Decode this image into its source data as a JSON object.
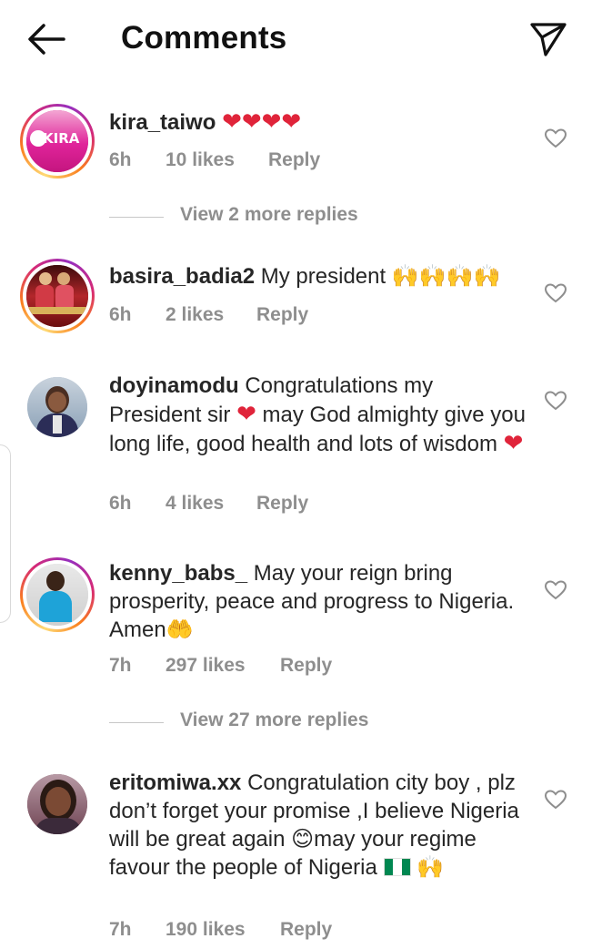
{
  "header": {
    "title": "Comments",
    "back_icon": "arrow-left-icon",
    "share_icon": "paper-plane-icon"
  },
  "comments": [
    {
      "username": "kira_taiwo",
      "text": "",
      "emoji_after": "❤❤❤❤",
      "time": "6h",
      "likes": "10 likes",
      "reply": "Reply",
      "view_replies": "View 2 more replies",
      "avatar_label": "KIRA"
    },
    {
      "username": "basira_badia2",
      "text": "My president",
      "emoji_after": "🙌🙌🙌🙌",
      "time": "6h",
      "likes": "2 likes",
      "reply": "Reply"
    },
    {
      "username": "doyinamodu",
      "text_parts": [
        "Congratulations my President sir",
        "may God almighty give you long life, good health and lots of wisdom"
      ],
      "time": "6h",
      "likes": "4 likes",
      "reply": "Reply"
    },
    {
      "username": "kenny_babs_",
      "text": "May your reign bring prosperity, peace and progress to Nigeria. Amen",
      "emoji_after": "🤲",
      "time": "7h",
      "likes": "297 likes",
      "reply": "Reply",
      "view_replies": "View 27 more replies"
    },
    {
      "username": "eritomiwa.xx",
      "text_parts": [
        "Congratulation city boy , plz don’t forget your promise ,I believe Nigeria will be great again",
        "may your regime favour the people of Nigeria"
      ],
      "time": "7h",
      "likes": "190 likes",
      "reply": "Reply"
    }
  ],
  "colors": {
    "text": "#262626",
    "meta": "#8e8e8e",
    "heart": "#e0243a"
  }
}
